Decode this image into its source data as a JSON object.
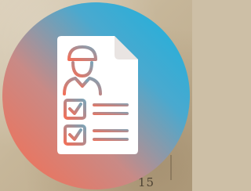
{
  "icon": {
    "name": "employee-checklist-icon",
    "accent_gradient": [
      "#f86c4f",
      "#18b2de"
    ],
    "document_color": "#ffffff",
    "checklist": [
      {
        "checked": true,
        "line_lengths": [
          "long",
          "short"
        ]
      },
      {
        "checked": true,
        "line_lengths": [
          "long",
          "short"
        ]
      }
    ]
  },
  "background": {
    "visible_text": "15"
  }
}
